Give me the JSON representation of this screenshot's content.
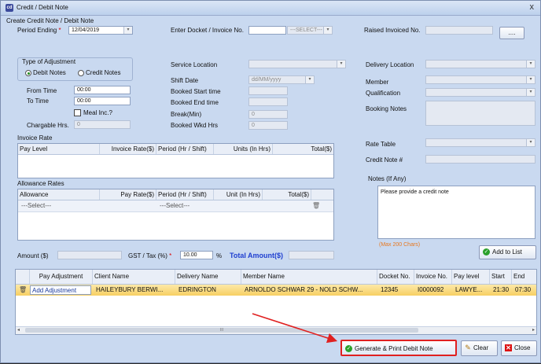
{
  "window": {
    "title": "Credit / Debit Note",
    "subtitle": "Create Credit Note / Debit Note",
    "close": "x"
  },
  "header": {
    "period_label": "Period Ending",
    "period_value": "12/04/2019",
    "docket_label": "Enter Docket / Invoice No.",
    "docket_value": "",
    "docket_select": "---SELECT---",
    "raised_label": "Raised Invoiced No.",
    "raised_button": "...."
  },
  "adjustment": {
    "label": "Type of Adjustment",
    "debit": "Debit Notes",
    "credit": "Credit Notes",
    "selected": "Debit Notes"
  },
  "time": {
    "from_label": "From Time",
    "from_value": "00:00",
    "to_label": "To Time",
    "to_value": "00:00",
    "meal_label": "Meal Inc.?",
    "chargeable_label": "Chargable Hrs.",
    "chargeable_value": "0"
  },
  "service": {
    "location_label": "Service Location",
    "shift_date_label": "Shift Date",
    "shift_date_value": "dd/MM/yyyy",
    "booked_start_label": "Booked Start time",
    "booked_end_label": "Booked End time",
    "break_label": "Break(Min)",
    "break_value": "0",
    "wkd_label": "Booked Wkd Hrs",
    "wkd_value": "0"
  },
  "right": {
    "delivery_label": "Delivery Location",
    "member_label": "Member",
    "qualification_label": "Qualification",
    "booking_notes_label": "Booking Notes",
    "rate_table_label": "Rate Table",
    "credit_note_label": "Credit Note #",
    "notes_label": "Notes (If Any)",
    "notes_value": "Please provide a credit note",
    "max_chars": "(Max 200  Chars)",
    "add_list": "Add to List"
  },
  "invoice_rate": {
    "title": "Invoice Rate",
    "columns": [
      "Pay Level",
      "Invoice Rate($)",
      "Period (Hr / Shift)",
      "Units (In Hrs)",
      "Total($)"
    ]
  },
  "allowance": {
    "title": "Allowance Rates",
    "columns": [
      "Allowance",
      "Pay Rate($)",
      "Period (Hr / Shift)",
      "Unit (In Hrs)",
      "Total($)"
    ],
    "row": {
      "allowance": "---Select---",
      "period": "---Select---"
    }
  },
  "totals": {
    "amount_label": "Amount ($)",
    "gst_label": "GST / Tax (%)",
    "gst_value": "10.00",
    "percent": "%",
    "total_label": "Total Amount($)"
  },
  "bottom_grid": {
    "columns": [
      "Pay Adjustment",
      "Client Name",
      "Delivery Name",
      "Member Name",
      "Docket No.",
      "Invoice No.",
      "Pay level",
      "Start",
      "End"
    ],
    "row": {
      "pay_adjustment": "Add Adjustment",
      "client": "HAILEYBURY  BERWI...",
      "delivery": "EDRINGTON",
      "member": "ARNOLDO SCHWAR 29 - NOLD SCHW...",
      "docket": "12345",
      "invoice": "I0000092",
      "pay_level": "LAWYE...",
      "start": "21:30",
      "end": "07:30"
    },
    "scroll_mark": "III"
  },
  "actions": {
    "generate": "Generate & Print Debit Note",
    "clear": "Clear",
    "close": "Close"
  },
  "colors": {
    "accent_red": "#e02020",
    "highlight_row": "#f7cf62",
    "total_blue": "#1f3fd0"
  }
}
